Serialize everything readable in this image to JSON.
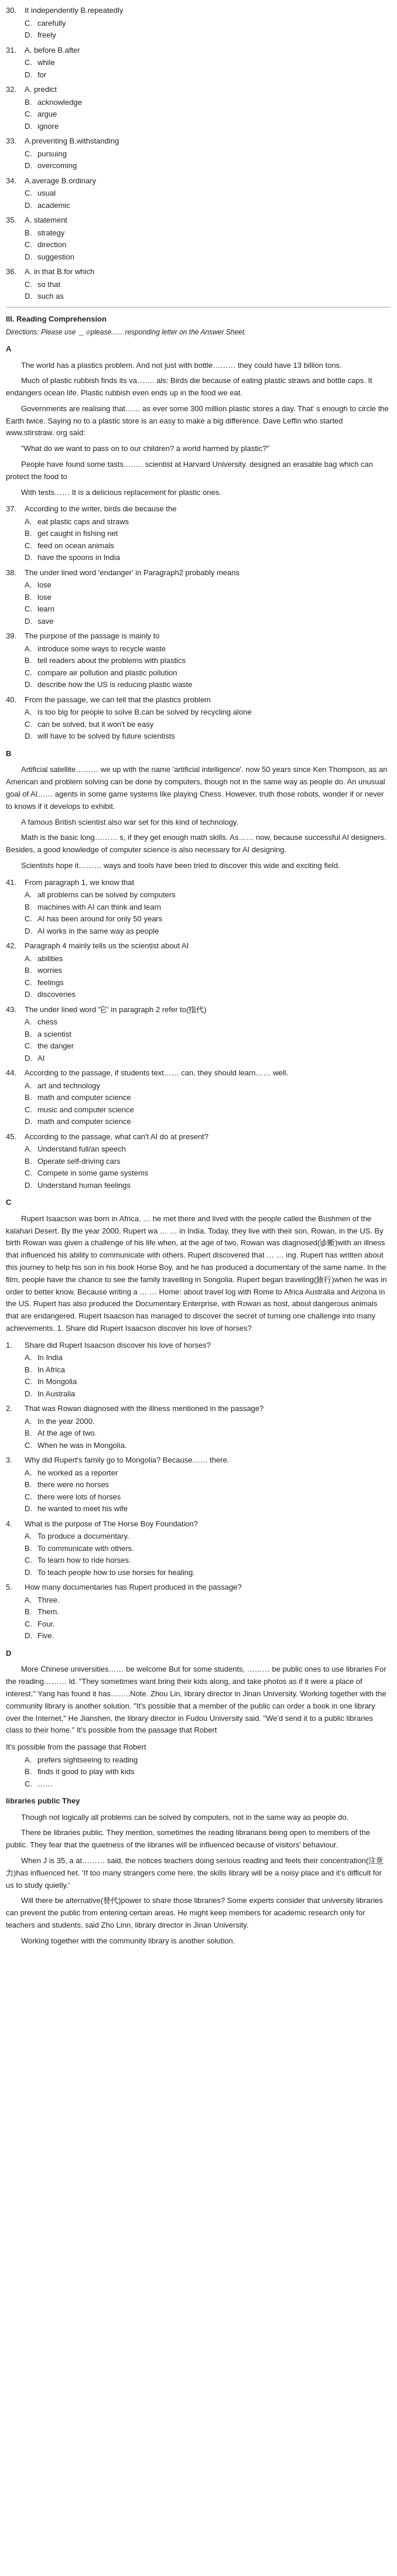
{
  "content": {
    "sections": [
      {
        "id": "q30",
        "number": "30.",
        "text": "It   independently  B.repeatedly",
        "options": [
          {
            "letter": "C.",
            "text": "carefully"
          },
          {
            "letter": "D.",
            "text": "freely"
          }
        ]
      },
      {
        "id": "q31",
        "number": "31.",
        "text": "A. before  B.after",
        "options": [
          {
            "letter": "C.",
            "text": "while"
          },
          {
            "letter": "D.",
            "text": "for"
          }
        ]
      },
      {
        "id": "q32",
        "number": "32.",
        "text": "A. predict",
        "options": [
          {
            "letter": "B.",
            "text": "acknowledge"
          },
          {
            "letter": "C.",
            "text": "argue"
          },
          {
            "letter": "D.",
            "text": "ignore"
          }
        ]
      },
      {
        "id": "q33",
        "number": "33.",
        "text": "A.preventing  B.withstanding",
        "options": [
          {
            "letter": "C.",
            "text": "pursuing"
          },
          {
            "letter": "D.",
            "text": "overcoming"
          }
        ]
      },
      {
        "id": "q34",
        "number": "34.",
        "text": "A.average  B.ordinary",
        "options": [
          {
            "letter": "C.",
            "text": "usual"
          },
          {
            "letter": "D.",
            "text": "academic"
          }
        ]
      },
      {
        "id": "q35",
        "number": "35.",
        "text": "A. statement",
        "options": [
          {
            "letter": "B.",
            "text": "strategy"
          },
          {
            "letter": "C.",
            "text": "direction"
          },
          {
            "letter": "D.",
            "text": "suggestion"
          }
        ]
      },
      {
        "id": "q36",
        "number": "36.",
        "text": "A. in that  B.for  which",
        "options": [
          {
            "letter": "C.",
            "text": "so that"
          },
          {
            "letter": "D.",
            "text": "such as"
          }
        ]
      }
    ],
    "section3_title": "III. Reading Comprehension",
    "section3_instruction": "Directions: Please use ＿⊙please...... responding letter on the  Answer  Sheet.",
    "passage_a_label": "A",
    "passage_a_text": [
      "The world has a plastics problem. And not just with bottle……… they could have 13 billion tons.",
      "Much of plastic rubbish finds its va……. als: Birds die because of eating plastic straws and bottle caps.  It endangers ocean life. Plastic rubbish even ends up in the food we eat.",
      "Governments are realising that……  as ever some 300 million plastic stores a day. That' s enough to circle the Earth twice. Saying no to a plastic store is an easy to make a big difference. Dave Leffin who started www.stirstraw. org said:",
      "\"What do we want to pass on to our children? a world harmed by plastic?\"",
      "People have found some tasts.……. scientist  at Harvard University. designed an erasable bag which can protect the food to",
      "With tests……  It is a delicious replacement for plastic ones."
    ],
    "questions_a": [
      {
        "id": "q37",
        "number": "37.",
        "text": "According to the writer, birds die because the",
        "options": [
          {
            "letter": "A.",
            "text": "eat plastic caps and straws"
          },
          {
            "letter": "B.",
            "text": "get caught in fishing net"
          },
          {
            "letter": "C.",
            "text": "feed on ocean animals"
          },
          {
            "letter": "D.",
            "text": "have the spoons in India"
          }
        ]
      },
      {
        "id": "q38",
        "number": "38.",
        "text": "The under lined word  'endanger'  in Paragraph2 probably means",
        "options": [
          {
            "letter": "A.",
            "text": "lose"
          },
          {
            "letter": "B.",
            "text": "lose"
          },
          {
            "letter": "C.",
            "text": "learn"
          },
          {
            "letter": "D.",
            "text": "save"
          }
        ]
      },
      {
        "id": "q39",
        "number": "39.",
        "text": "The purpose of the passage is mainly to",
        "options": [
          {
            "letter": "A.",
            "text": "introduce some ways to recycle waste"
          },
          {
            "letter": "B.",
            "text": "tell readers about the problems with plastics"
          },
          {
            "letter": "C.",
            "text": "compare air pollution and plastic pollution"
          },
          {
            "letter": "D.",
            "text": "describe how the US is reducing plastic waste"
          }
        ]
      },
      {
        "id": "q40",
        "number": "40.",
        "text": "From the passage, we can tell that the plastics problem",
        "options": [
          {
            "letter": "A.",
            "text": "is too big for people to solve   B.can be solved by recycling alone"
          },
          {
            "letter": "C.",
            "text": "can be solved, but it won't be easy"
          },
          {
            "letter": "D.",
            "text": "will have to be solved by future scientists"
          }
        ]
      }
    ],
    "passage_b_label": "B",
    "passage_b_text": [
      "Artificial  satellite……… we  up  with  the  name  'artificial intelligence'.  now  50 years  since  Ken  Thompson,  as   an  American  and problem solving  can be done by computers, though not in the same way as people do. An unusual goal of AI……  agents in some game systems like playing Chess. However, truth those robots, wonder if or never to knows if it  develops  to  exhibit.",
      "A  famous  British scientist also war set for this kind of technology.",
      "Math  is  the basic long……… s, if they get enough math skills. As……  now, because  successful  AI  designers. Besides, a  good  knowledge of computer science  is  also necessary  for  AI  designing.",
      "Scientists hope  it……… ways and tools have been tried to discover  this wide and exciting  field."
    ],
    "questions_b": [
      {
        "id": "q41",
        "number": "41.",
        "text": "From paragraph 1, we know that",
        "options": [
          {
            "letter": "A.",
            "text": "all problems can be solved by computers"
          },
          {
            "letter": "B.",
            "text": "machines with AI can think and learn"
          },
          {
            "letter": "C.",
            "text": "AI has been around for only 50 years"
          },
          {
            "letter": "D.",
            "text": "AI works in the same way as people"
          }
        ]
      },
      {
        "id": "q42",
        "number": "42.",
        "text": "Paragraph 4 mainly tells us the scientist about AI",
        "options": [
          {
            "letter": "A.",
            "text": "abilities"
          },
          {
            "letter": "B.",
            "text": "worries"
          },
          {
            "letter": "C.",
            "text": "feelings"
          },
          {
            "letter": "D.",
            "text": "discoveries"
          }
        ]
      },
      {
        "id": "q43",
        "number": "43.",
        "text": "The under lined word  '它' in paragraph 2 refer to(指代)",
        "options": [
          {
            "letter": "A.",
            "text": "chess"
          },
          {
            "letter": "B.",
            "text": "a scientist"
          },
          {
            "letter": "C.",
            "text": "the danger"
          },
          {
            "letter": "D.",
            "text": "AI"
          }
        ]
      },
      {
        "id": "q44",
        "number": "44.",
        "text": "According to the passage, if students text……  can, they should learn……  well.",
        "options": [
          {
            "letter": "A.",
            "text": "art and technology"
          },
          {
            "letter": "B.",
            "text": "math and computer science"
          },
          {
            "letter": "C.",
            "text": "music and computer science"
          },
          {
            "letter": "D.",
            "text": "math and computer science"
          }
        ]
      },
      {
        "id": "q45",
        "number": "45.",
        "text": "According to the passage, what can't AI do at present?",
        "options": [
          {
            "letter": "A.",
            "text": "Understand full/an speech"
          },
          {
            "letter": "B.",
            "text": "Operate self-driving cars"
          },
          {
            "letter": "C.",
            "text": "Compete in some game systems"
          },
          {
            "letter": "D.",
            "text": "Understand human feelings"
          }
        ]
      }
    ],
    "passage_c_label": "C",
    "passage_c_intro": "Rupert Isaacson was born in Africa. … he met there and lived with the people called the Bushmen of the kalahari Desert. By the year 2000, Rupert wa … … in India. Today, they live with their son, Rowan, in the US. By birth Rowan was given a challenge of his life when, at the age of two, Rowan was diagnosed(诊断)with an illness that influenced his ability to communicate with others. Rupert discovered that … … ing. Rupert has written about this journey to help his son in his book Horse Boy, and he has produced a documentary of the same name. In the film, people have the chance to see the family travelling in Songolia. Rupert began traveling(旅行)when he was in order to better know. Because writing a … … Home: about travel log with Rome to Africa Australia and Arizona in the US. Rupert has also produced the Documentary Enterprise, with Rowan as host, about dangerous animals that are endangered. Rupert Isaacson has managed to discover the secret of turning one challenge into many achievements. 1. Share did Rupert Isaacson discover his love of horses?",
    "questions_c": [
      {
        "id": "qc1",
        "number": "1.",
        "text": "Share did Rupert Isaacson discover his love of horses?",
        "options": [
          {
            "letter": "A.",
            "text": "In India"
          },
          {
            "letter": "B.",
            "text": "In Africa"
          },
          {
            "letter": "C.",
            "text": "In Mongolia"
          },
          {
            "letter": "D.",
            "text": "In Australia"
          }
        ]
      },
      {
        "id": "qc2",
        "number": "2.",
        "text": "That was Rowan diagnosed with the illness mentioned in the passage?",
        "options": [
          {
            "letter": "A.",
            "text": "In the year 2000."
          },
          {
            "letter": "B.",
            "text": "At the age of two."
          },
          {
            "letter": "C.",
            "text": "When he was in Mongolia."
          }
        ]
      },
      {
        "id": "qc3",
        "number": "3.",
        "text": "Why did Rupert's family go to Mongolia? Because……  there.",
        "options": [
          {
            "letter": "A.",
            "text": "he worked as a reporter"
          },
          {
            "letter": "B.",
            "text": "there were no horses"
          },
          {
            "letter": "C.",
            "text": "there were lots of horses"
          },
          {
            "letter": "D.",
            "text": "he wanted to meet his wife"
          }
        ]
      },
      {
        "id": "qc4",
        "number": "4.",
        "text": "What is the purpose of The Horse Boy Foundation?",
        "options": [
          {
            "letter": "A.",
            "text": "To produce a documentary."
          },
          {
            "letter": "B.",
            "text": "To communicate with others."
          },
          {
            "letter": "C.",
            "text": "To learn how to ride horses."
          },
          {
            "letter": "D.",
            "text": "To teach people how to use horses for healing."
          }
        ]
      },
      {
        "id": "qc5",
        "number": "5.",
        "text": "How many documentaries has Rupert produced in the passage?",
        "options": [
          {
            "letter": "A.",
            "text": "Three."
          },
          {
            "letter": "B.",
            "text": "Them."
          },
          {
            "letter": "C.",
            "text": "Four."
          },
          {
            "letter": "D.",
            "text": "Five."
          }
        ]
      }
    ],
    "passage_d_label": "D",
    "passage_d_intro": "More Chinese universities…… be welcome But for some students, ……… be public ones to use libraries For the reading……… ld. \"They sometimes want bring their kids along, and take photos as if it were a place of interest.\" Yang has found it has……..Note. Zhou Lin, library director in Jinan University. Working together with the community library is another solution. \"It's possible that a member of the public can order a book in one library over the Internet,\" He Jianshen, the library director in Fudou University said. \"We'd send it to a public libraries class to their home.\" It's possible from the passage that Robert",
    "questions_d": [
      {
        "id": "qd1",
        "number": "",
        "text": "It's possible from the passage that Robert",
        "options": [
          {
            "letter": "A.",
            "text": "prefers sightseeing to reading"
          },
          {
            "letter": "B.",
            "text": "finds it good to play with kids"
          },
          {
            "letter": "C.",
            "text": "……"
          }
        ]
      }
    ],
    "passage_e_label": "libraries public They",
    "passage_e_lines": [
      "Though not logically all problems can be solved by computers, not in the same way as people do.",
      "There be libraries public. They mention, sometimes the reading librarians being open to members of the public. They fear that the quietness of the libraries will be influenced because of visitors' behaviour.",
      "When J is 35, a at……… said, the notices teachers doing serious reading and feels their concentration(注意力)has influenced het. 'If too many strangers come here, the skills library will be a noisy place and it's difficult for us to study quietly.'",
      "Will there be alternative(替代)power to share those libraries? Some experts consider that university libraries can prevent the public from entering certain areas. He might keep members for academic research only for teachers and students,  said Zho Linn, library director in Jinan University.",
      "Working together with the community library is another solution."
    ]
  }
}
